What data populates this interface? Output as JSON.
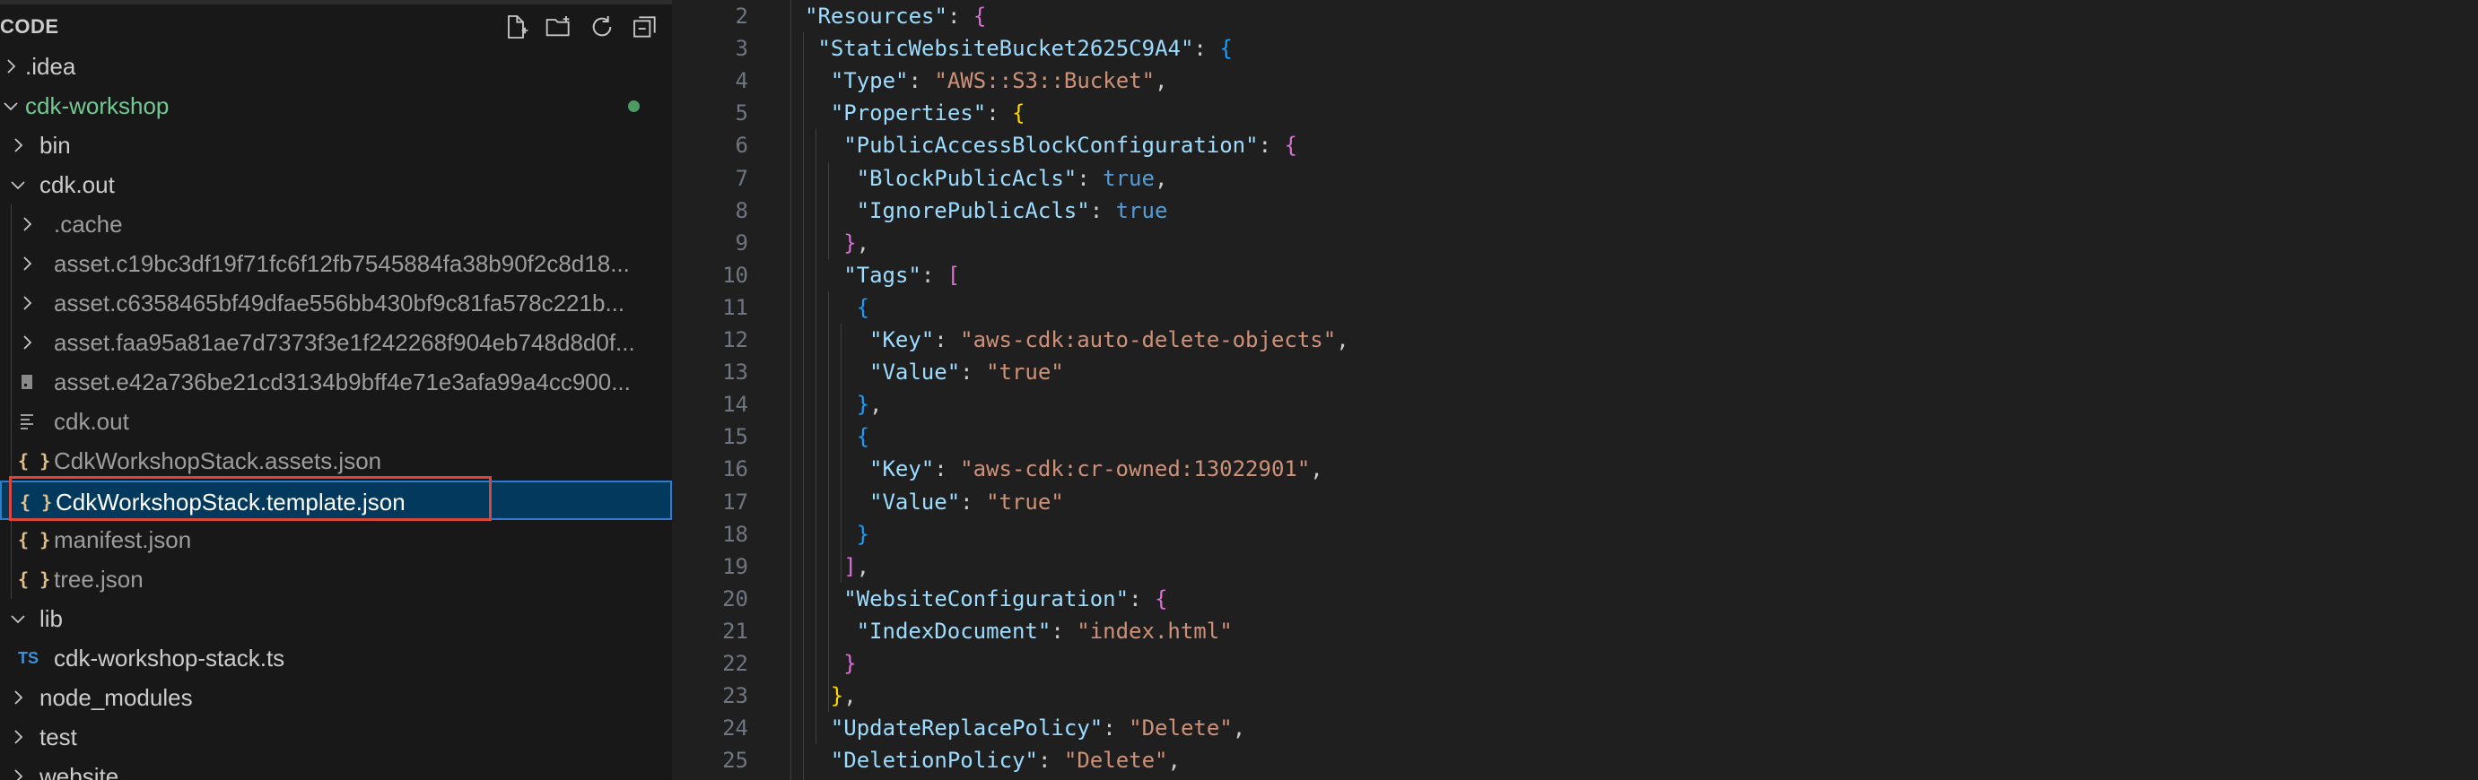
{
  "sidebar": {
    "title": "CODE",
    "actions": [
      "new-file-icon",
      "new-folder-icon",
      "refresh-icon",
      "collapse-all-icon"
    ],
    "tree": [
      {
        "label": ".idea",
        "type": "folder",
        "expanded": false,
        "depth": 0
      },
      {
        "label": "cdk-workshop",
        "type": "folder",
        "expanded": true,
        "depth": 0,
        "git_modified": true
      },
      {
        "label": "bin",
        "type": "folder",
        "expanded": false,
        "depth": 1
      },
      {
        "label": "cdk.out",
        "type": "folder",
        "expanded": true,
        "depth": 1
      },
      {
        "label": ".cache",
        "type": "folder",
        "expanded": false,
        "depth": 2
      },
      {
        "label": "asset.c19bc3df19f71fc6f12fb7545884fa38b90f2c8d18...",
        "type": "folder",
        "expanded": false,
        "depth": 2
      },
      {
        "label": "asset.c6358465bf49dfae556bb430bf9c81fa578c221b...",
        "type": "folder",
        "expanded": false,
        "depth": 2
      },
      {
        "label": "asset.faa95a81ae7d7373f3e1f242268f904eb748d8d0f...",
        "type": "folder",
        "expanded": false,
        "depth": 2
      },
      {
        "label": "asset.e42a736be21cd3134b9bff4e71e3afa99a4cc900...",
        "type": "binary",
        "depth": 2
      },
      {
        "label": "cdk.out",
        "type": "text",
        "depth": 2
      },
      {
        "label": "CdkWorkshopStack.assets.json",
        "type": "json",
        "depth": 2
      },
      {
        "label": "CdkWorkshopStack.template.json",
        "type": "json",
        "depth": 2,
        "selected": true
      },
      {
        "label": "manifest.json",
        "type": "json",
        "depth": 2
      },
      {
        "label": "tree.json",
        "type": "json",
        "depth": 2
      },
      {
        "label": "lib",
        "type": "folder",
        "expanded": true,
        "depth": 1
      },
      {
        "label": "cdk-workshop-stack.ts",
        "type": "ts",
        "depth": 1
      },
      {
        "label": "node_modules",
        "type": "folder",
        "expanded": false,
        "depth": 1
      },
      {
        "label": "test",
        "type": "folder",
        "expanded": false,
        "depth": 1
      },
      {
        "label": "website",
        "type": "folder",
        "expanded": false,
        "depth": 1
      }
    ],
    "icon_glyphs": {
      "json": "{ }",
      "ts": "TS"
    }
  },
  "editor": {
    "lines": [
      {
        "n": "2",
        "tokens": [
          [
            "k",
            "\"Resources\""
          ],
          [
            "p",
            ": "
          ],
          [
            "br2",
            "{"
          ]
        ]
      },
      {
        "n": "3",
        "tokens": [
          [
            "k",
            "\"StaticWebsiteBucket2625C9A4\""
          ],
          [
            "p",
            ": "
          ],
          [
            "br3",
            "{"
          ]
        ]
      },
      {
        "n": "4",
        "tokens": [
          [
            "k",
            "\"Type\""
          ],
          [
            "p",
            ": "
          ],
          [
            "s",
            "\"AWS::S3::Bucket\""
          ],
          [
            "p",
            ","
          ]
        ]
      },
      {
        "n": "5",
        "tokens": [
          [
            "k",
            "\"Properties\""
          ],
          [
            "p",
            ": "
          ],
          [
            "br1",
            "{"
          ]
        ]
      },
      {
        "n": "6",
        "tokens": [
          [
            "k",
            "\"PublicAccessBlockConfiguration\""
          ],
          [
            "p",
            ": "
          ],
          [
            "br2",
            "{"
          ]
        ]
      },
      {
        "n": "7",
        "tokens": [
          [
            "k",
            "\"BlockPublicAcls\""
          ],
          [
            "p",
            ": "
          ],
          [
            "b",
            "true"
          ],
          [
            "p",
            ","
          ]
        ]
      },
      {
        "n": "8",
        "tokens": [
          [
            "k",
            "\"IgnorePublicAcls\""
          ],
          [
            "p",
            ": "
          ],
          [
            "b",
            "true"
          ]
        ]
      },
      {
        "n": "9",
        "tokens": [
          [
            "br2",
            "}"
          ],
          [
            "p",
            ","
          ]
        ]
      },
      {
        "n": "10",
        "tokens": [
          [
            "k",
            "\"Tags\""
          ],
          [
            "p",
            ": "
          ],
          [
            "br2",
            "["
          ]
        ]
      },
      {
        "n": "11",
        "tokens": [
          [
            "br3",
            "{"
          ]
        ]
      },
      {
        "n": "12",
        "tokens": [
          [
            "k",
            "\"Key\""
          ],
          [
            "p",
            ": "
          ],
          [
            "s",
            "\"aws-cdk:auto-delete-objects\""
          ],
          [
            "p",
            ","
          ]
        ]
      },
      {
        "n": "13",
        "tokens": [
          [
            "k",
            "\"Value\""
          ],
          [
            "p",
            ": "
          ],
          [
            "s",
            "\"true\""
          ]
        ]
      },
      {
        "n": "14",
        "tokens": [
          [
            "br3",
            "}"
          ],
          [
            "p",
            ","
          ]
        ]
      },
      {
        "n": "15",
        "tokens": [
          [
            "br3",
            "{"
          ]
        ]
      },
      {
        "n": "16",
        "tokens": [
          [
            "k",
            "\"Key\""
          ],
          [
            "p",
            ": "
          ],
          [
            "s",
            "\"aws-cdk:cr-owned:13022901\""
          ],
          [
            "p",
            ","
          ]
        ]
      },
      {
        "n": "17",
        "tokens": [
          [
            "k",
            "\"Value\""
          ],
          [
            "p",
            ": "
          ],
          [
            "s",
            "\"true\""
          ]
        ]
      },
      {
        "n": "18",
        "tokens": [
          [
            "br3",
            "}"
          ]
        ]
      },
      {
        "n": "19",
        "tokens": [
          [
            "br2",
            "]"
          ],
          [
            "p",
            ","
          ]
        ]
      },
      {
        "n": "20",
        "tokens": [
          [
            "k",
            "\"WebsiteConfiguration\""
          ],
          [
            "p",
            ": "
          ],
          [
            "br2",
            "{"
          ]
        ]
      },
      {
        "n": "21",
        "tokens": [
          [
            "k",
            "\"IndexDocument\""
          ],
          [
            "p",
            ": "
          ],
          [
            "s",
            "\"index.html\""
          ]
        ]
      },
      {
        "n": "22",
        "tokens": [
          [
            "br2",
            "}"
          ]
        ]
      },
      {
        "n": "23",
        "tokens": [
          [
            "br1",
            "}"
          ],
          [
            "p",
            ","
          ]
        ]
      },
      {
        "n": "24",
        "tokens": [
          [
            "k",
            "\"UpdateReplacePolicy\""
          ],
          [
            "p",
            ": "
          ],
          [
            "s",
            "\"Delete\""
          ],
          [
            "p",
            ","
          ]
        ]
      },
      {
        "n": "25",
        "tokens": [
          [
            "k",
            "\"DeletionPolicy\""
          ],
          [
            "p",
            ": "
          ],
          [
            "s",
            "\"Delete\""
          ],
          [
            "p",
            ","
          ]
        ]
      }
    ]
  },
  "colors": {
    "sidebar_bg": "#181818",
    "editor_bg": "#1f1f1f",
    "selection_bg": "#04395e",
    "highlight_border": "#d9473a",
    "git_modified": "#73c991"
  }
}
